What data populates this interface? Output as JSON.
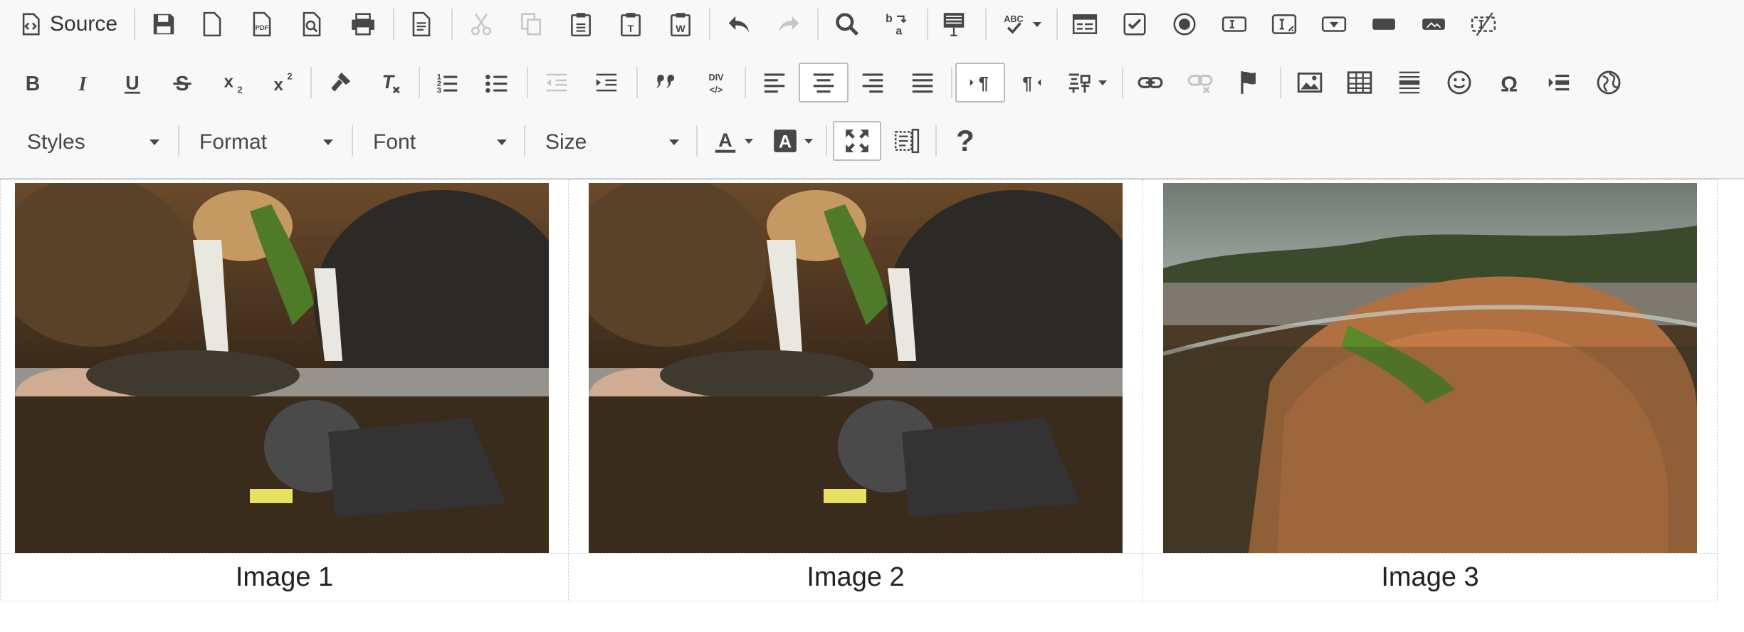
{
  "toolbar": {
    "source_label": "Source",
    "combos": {
      "styles": "Styles",
      "format": "Format",
      "font": "Font",
      "size": "Size"
    },
    "help_label": "?"
  },
  "icons": {
    "row1": [
      "source-icon",
      "save-icon",
      "new-page-icon",
      "export-pdf-icon",
      "preview-icon",
      "print-icon",
      "templates-icon",
      "cut-icon",
      "copy-icon",
      "paste-icon",
      "paste-text-icon",
      "paste-from-word-icon",
      "undo-icon",
      "redo-icon",
      "find-icon",
      "replace-icon",
      "select-all-icon",
      "spell-check-icon",
      "form-icon",
      "checkbox-icon",
      "radio-icon",
      "text-field-icon",
      "textarea-icon",
      "select-field-icon",
      "button-icon",
      "image-button-icon",
      "hidden-field-icon"
    ],
    "row2": [
      "bold-icon",
      "italic-icon",
      "underline-icon",
      "strike-icon",
      "subscript-icon",
      "superscript-icon",
      "copy-formatting-icon",
      "remove-format-icon",
      "numbered-list-icon",
      "bulleted-list-icon",
      "outdent-icon",
      "indent-icon",
      "blockquote-icon",
      "create-div-icon",
      "align-left-icon",
      "align-center-icon",
      "align-right-icon",
      "justify-icon",
      "ltr-icon",
      "rtl-icon",
      "language-icon",
      "link-icon",
      "unlink-icon",
      "anchor-icon",
      "image-icon",
      "table-icon",
      "horizontal-line-icon",
      "smiley-icon",
      "special-char-icon",
      "page-break-icon",
      "iframe-icon"
    ],
    "row3": [
      "text-color-icon",
      "background-color-icon",
      "maximize-icon",
      "show-blocks-icon",
      "help-icon"
    ]
  },
  "content": {
    "images": [
      {
        "caption": "Image 1",
        "alt": "Image 1"
      },
      {
        "caption": "Image 2",
        "alt": "Image 2"
      },
      {
        "caption": "Image 3",
        "alt": "Image 3"
      }
    ]
  }
}
